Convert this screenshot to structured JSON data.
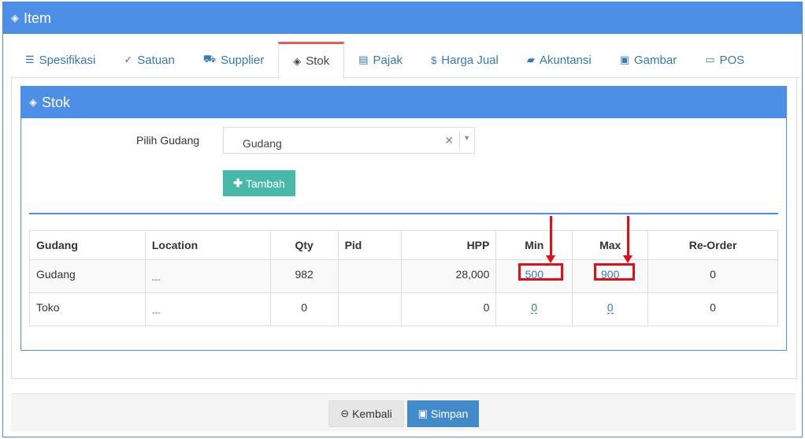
{
  "window": {
    "title": "Item",
    "icon": "cube-icon"
  },
  "tabs": [
    {
      "label": "Spesifikasi",
      "icon": "list-icon",
      "glyph": "☰"
    },
    {
      "label": "Satuan",
      "icon": "check-circle-icon",
      "glyph": "✓"
    },
    {
      "label": "Supplier",
      "icon": "truck-icon",
      "glyph": "⛟"
    },
    {
      "label": "Stok",
      "icon": "cube-icon",
      "glyph": "◈",
      "active": true
    },
    {
      "label": "Pajak",
      "icon": "list-alt-icon",
      "glyph": "▤"
    },
    {
      "label": "Harga Jual",
      "icon": "dollar-icon",
      "glyph": "$"
    },
    {
      "label": "Akuntansi",
      "icon": "book-icon",
      "glyph": "▰"
    },
    {
      "label": "Gambar",
      "icon": "image-icon",
      "glyph": "▣"
    },
    {
      "label": "POS",
      "icon": "monitor-icon",
      "glyph": "▭"
    }
  ],
  "panel": {
    "title": "Stok",
    "pilih_label": "Pilih Gudang",
    "select_value": "Gudang",
    "add_button": "Tambah"
  },
  "table": {
    "headers": [
      "Gudang",
      "Location",
      "Qty",
      "Pid",
      "HPP",
      "Min",
      "Max",
      "Re-Order"
    ],
    "rows": [
      {
        "gudang": "Gudang",
        "location": "---",
        "qty": "982",
        "pid": "",
        "hpp": "28,000",
        "min": "500",
        "max": "900",
        "reorder": "0"
      },
      {
        "gudang": "Toko",
        "location": "---",
        "qty": "0",
        "pid": "",
        "hpp": "0",
        "min": "0",
        "max": "0",
        "reorder": "0"
      }
    ]
  },
  "footer": {
    "back": "Kembali",
    "save": "Simpan"
  },
  "colors": {
    "header_blue": "#4d8ee6",
    "add_green": "#48b9a9",
    "save_blue": "#428bca",
    "highlight_red": "#e0101a",
    "active_tab_top": "#e85c5c"
  }
}
